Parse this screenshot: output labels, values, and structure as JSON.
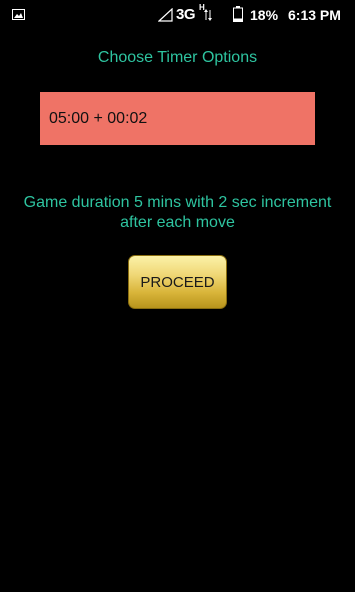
{
  "status_bar": {
    "network": "3G",
    "network_sub": "H",
    "battery": "18%",
    "time": "6:13 PM",
    "icons": [
      "image-icon",
      "signal-icon",
      "data-arrows-icon",
      "battery-icon"
    ]
  },
  "main": {
    "title": "Choose Timer Options",
    "timer_value": "05:00 + 00:02",
    "description": "Game duration 5 mins with 2 sec increment after each move",
    "proceed_label": "PROCEED"
  },
  "colors": {
    "accent_text": "#2ec4a0",
    "timer_field_bg": "#ef7366",
    "button_gold": "#d9b53a",
    "background": "#000000"
  }
}
